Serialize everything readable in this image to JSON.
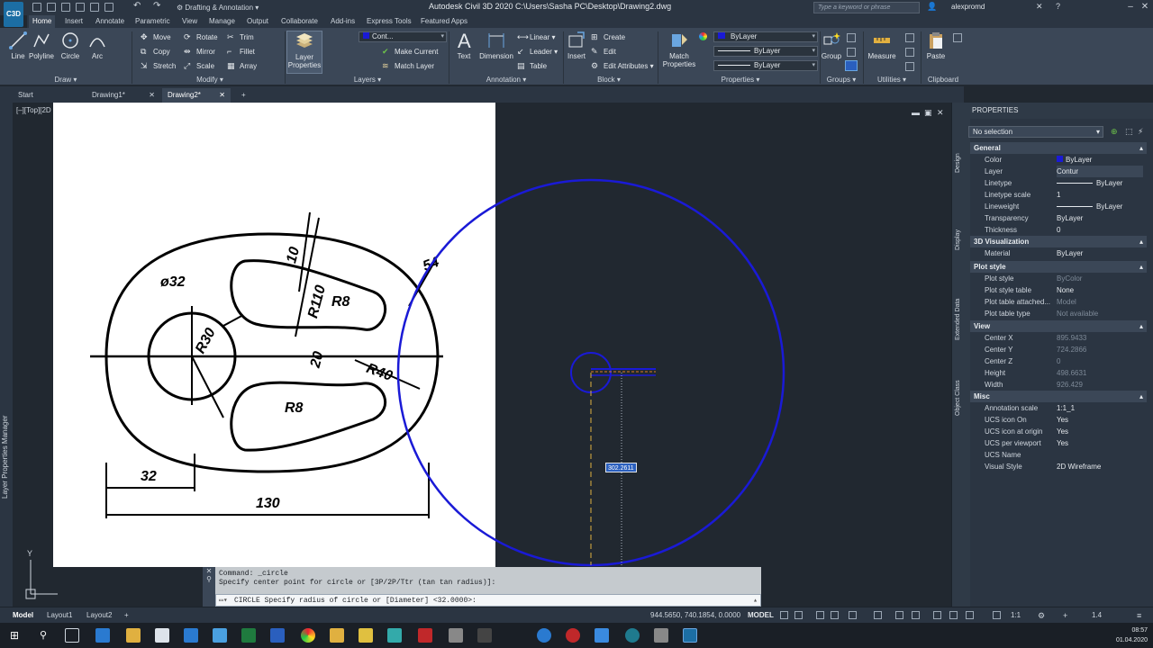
{
  "titlebar": {
    "app_badge": "C3D",
    "workspace": "Drafting & Annotation",
    "title": "Autodesk Civil 3D 2020    C:\\Users\\Sasha PC\\Desktop\\Drawing2.dwg",
    "search_placeholder": "Type a keyword or phrase",
    "user": "alexpromd"
  },
  "menu_tabs": [
    "Home",
    "Insert",
    "Annotate",
    "Parametric",
    "View",
    "Manage",
    "Output",
    "Collaborate",
    "Add-ins",
    "Express Tools",
    "Featured Apps"
  ],
  "ribbon": {
    "draw": {
      "title": "Draw",
      "line": "Line",
      "polyline": "Polyline",
      "circle": "Circle",
      "arc": "Arc"
    },
    "modify": {
      "title": "Modify",
      "move": "Move",
      "rotate": "Rotate",
      "trim": "Trim",
      "copy": "Copy",
      "mirror": "Mirror",
      "fillet": "Fillet",
      "stretch": "Stretch",
      "scale": "Scale",
      "array": "Array"
    },
    "layers": {
      "title": "Layers",
      "layer_properties": "Layer Properties",
      "layer_combo": "Cont...",
      "make_current": "Make Current",
      "match_layer": "Match Layer"
    },
    "annotation": {
      "title": "Annotation",
      "text": "Text",
      "dimension": "Dimension",
      "linear": "Linear",
      "leader": "Leader",
      "table": "Table"
    },
    "block": {
      "title": "Block",
      "insert": "Insert",
      "create": "Create",
      "edit": "Edit",
      "edit_attributes": "Edit Attributes"
    },
    "properties": {
      "title": "Properties",
      "match_properties": "Match Properties",
      "color": "ByLayer",
      "linetype": "ByLayer",
      "lineweight": "ByLayer"
    },
    "groups": {
      "title": "Groups",
      "group": "Group"
    },
    "utilities": {
      "title": "Utilities",
      "measure": "Measure"
    },
    "clipboard": {
      "title": "Clipboard",
      "paste": "Paste"
    }
  },
  "file_tabs": [
    "Start",
    "Drawing1*",
    "Drawing2*"
  ],
  "viewport": {
    "label": "[–][Top][2D",
    "radius_tooltip": "302.2611"
  },
  "drawing_dimensions": [
    "ø32",
    "10",
    "R110",
    "R8",
    "R30",
    "20",
    "R40",
    "R8",
    "54",
    "32",
    "130"
  ],
  "left_palette": "Layer Properties Manager",
  "command": {
    "line1": "Command: _circle",
    "line2": "Specify center point for circle or [3P/2P/Ttr (tan tan radius)]:",
    "prompt": "CIRCLE Specify radius of circle or [Diameter] <32.0000>:"
  },
  "properties": {
    "header": "PROPERTIES",
    "selection": "No selection",
    "side_tabs": [
      "Design",
      "Display",
      "Extended Data",
      "Object Class"
    ],
    "sections": [
      {
        "title": "General",
        "rows": [
          [
            "Color",
            "ByLayer"
          ],
          [
            "Layer",
            "Contur"
          ],
          [
            "Linetype",
            "ByLayer"
          ],
          [
            "Linetype scale",
            "1"
          ],
          [
            "Lineweight",
            "ByLayer"
          ],
          [
            "Transparency",
            "ByLayer"
          ],
          [
            "Thickness",
            "0"
          ]
        ]
      },
      {
        "title": "3D Visualization",
        "rows": [
          [
            "Material",
            "ByLayer"
          ]
        ]
      },
      {
        "title": "Plot style",
        "rows": [
          [
            "Plot style",
            "ByColor"
          ],
          [
            "Plot style table",
            "None"
          ],
          [
            "Plot table attached...",
            "Model"
          ],
          [
            "Plot table type",
            "Not available"
          ]
        ]
      },
      {
        "title": "View",
        "rows": [
          [
            "Center X",
            "895.9433"
          ],
          [
            "Center Y",
            "724.2866"
          ],
          [
            "Center Z",
            "0"
          ],
          [
            "Height",
            "498.6631"
          ],
          [
            "Width",
            "926.429"
          ]
        ]
      },
      {
        "title": "Misc",
        "rows": [
          [
            "Annotation scale",
            "1:1_1"
          ],
          [
            "UCS icon On",
            "Yes"
          ],
          [
            "UCS icon at origin",
            "Yes"
          ],
          [
            "UCS per viewport",
            "Yes"
          ],
          [
            "UCS Name",
            ""
          ],
          [
            "Visual Style",
            "2D Wireframe"
          ]
        ]
      }
    ]
  },
  "statusbar": {
    "layouts": [
      "Model",
      "Layout1",
      "Layout2"
    ],
    "coords": "944.5650, 740.1854, 0.0000",
    "model": "MODEL",
    "scale": "1:1",
    "lineweight_scale": "1.4"
  },
  "taskbar": {
    "time": "08:57",
    "date": "01.04.2020"
  },
  "colors": {
    "accent": "#1c6ea4",
    "circle": "#1a1ad6",
    "dim_line": "#e07a1f"
  }
}
